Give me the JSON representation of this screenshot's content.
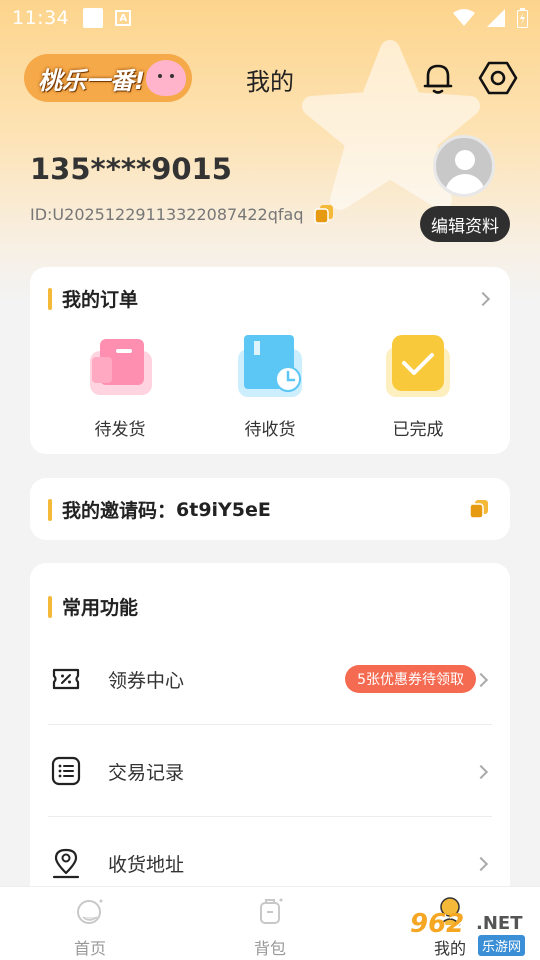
{
  "status_bar": {
    "time": "11:34"
  },
  "header": {
    "logo_text": "桃乐一番!",
    "title": "我的"
  },
  "user": {
    "phone": "135****9015",
    "id": "ID:U20251229113322087422qfaq",
    "edit_label": "编辑资料"
  },
  "orders": {
    "title": "我的订单",
    "items": [
      {
        "label": "待发货",
        "icon": "truck-icon",
        "color": "#ff8fb0"
      },
      {
        "label": "待收货",
        "icon": "box-clock-icon",
        "color": "#5cc6f5"
      },
      {
        "label": "已完成",
        "icon": "check-clipboard-icon",
        "color": "#f8c93a"
      }
    ]
  },
  "invite": {
    "label": "我的邀请码：",
    "code": "6t9iY5eE"
  },
  "functions": {
    "title": "常用功能",
    "items": [
      {
        "label": "领券中心",
        "icon": "coupon-icon",
        "badge": "5张优惠券待领取"
      },
      {
        "label": "交易记录",
        "icon": "list-icon"
      },
      {
        "label": "收货地址",
        "icon": "location-icon"
      }
    ]
  },
  "tabbar": {
    "items": [
      {
        "label": "首页",
        "icon": "home-icon"
      },
      {
        "label": "背包",
        "icon": "backpack-icon"
      },
      {
        "label": "我的",
        "icon": "profile-icon"
      }
    ]
  },
  "watermark": {
    "text": "962",
    "net": ".NET",
    "cn": "乐游网"
  },
  "colors": {
    "accent": "#f5b93a",
    "badge": "#f56b52",
    "dark_button": "#2f2f2f"
  }
}
